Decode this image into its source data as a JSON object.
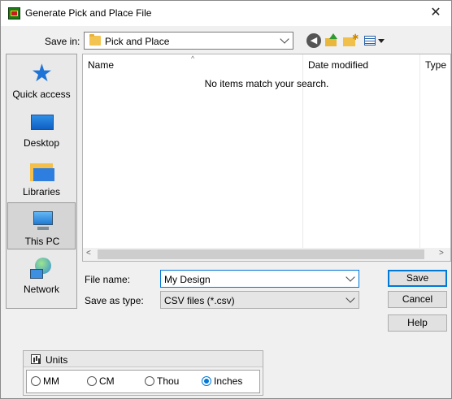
{
  "window": {
    "title": "Generate Pick and Place File",
    "close_glyph": "✕"
  },
  "toolbar": {
    "save_in_label": "Save in:",
    "location": "Pick and Place",
    "icons": [
      "back-icon",
      "up-folder-icon",
      "new-folder-icon",
      "view-menu-icon"
    ]
  },
  "places": [
    {
      "label": "Quick access",
      "icon": "star-icon"
    },
    {
      "label": "Desktop",
      "icon": "desktop-icon"
    },
    {
      "label": "Libraries",
      "icon": "libraries-icon"
    },
    {
      "label": "This PC",
      "icon": "computer-icon",
      "selected": true
    },
    {
      "label": "Network",
      "icon": "network-icon"
    }
  ],
  "filelist": {
    "columns": [
      "Name",
      "Date modified",
      "Type"
    ],
    "empty_message": "No items match your search.",
    "sort_glyph": "^",
    "scroll_left": "<",
    "scroll_right": ">"
  },
  "form": {
    "filename_label": "File name:",
    "filename_value": "My Design",
    "type_label": "Save as type:",
    "type_value": "CSV files (*.csv)"
  },
  "buttons": {
    "save": "Save",
    "cancel": "Cancel",
    "help": "Help"
  },
  "units": {
    "title": "Units",
    "options": [
      "MM",
      "CM",
      "Thou",
      "Inches"
    ],
    "selected": "Inches"
  },
  "colors": {
    "accent": "#0078d7",
    "dialog_bg": "#f0f0f0"
  }
}
